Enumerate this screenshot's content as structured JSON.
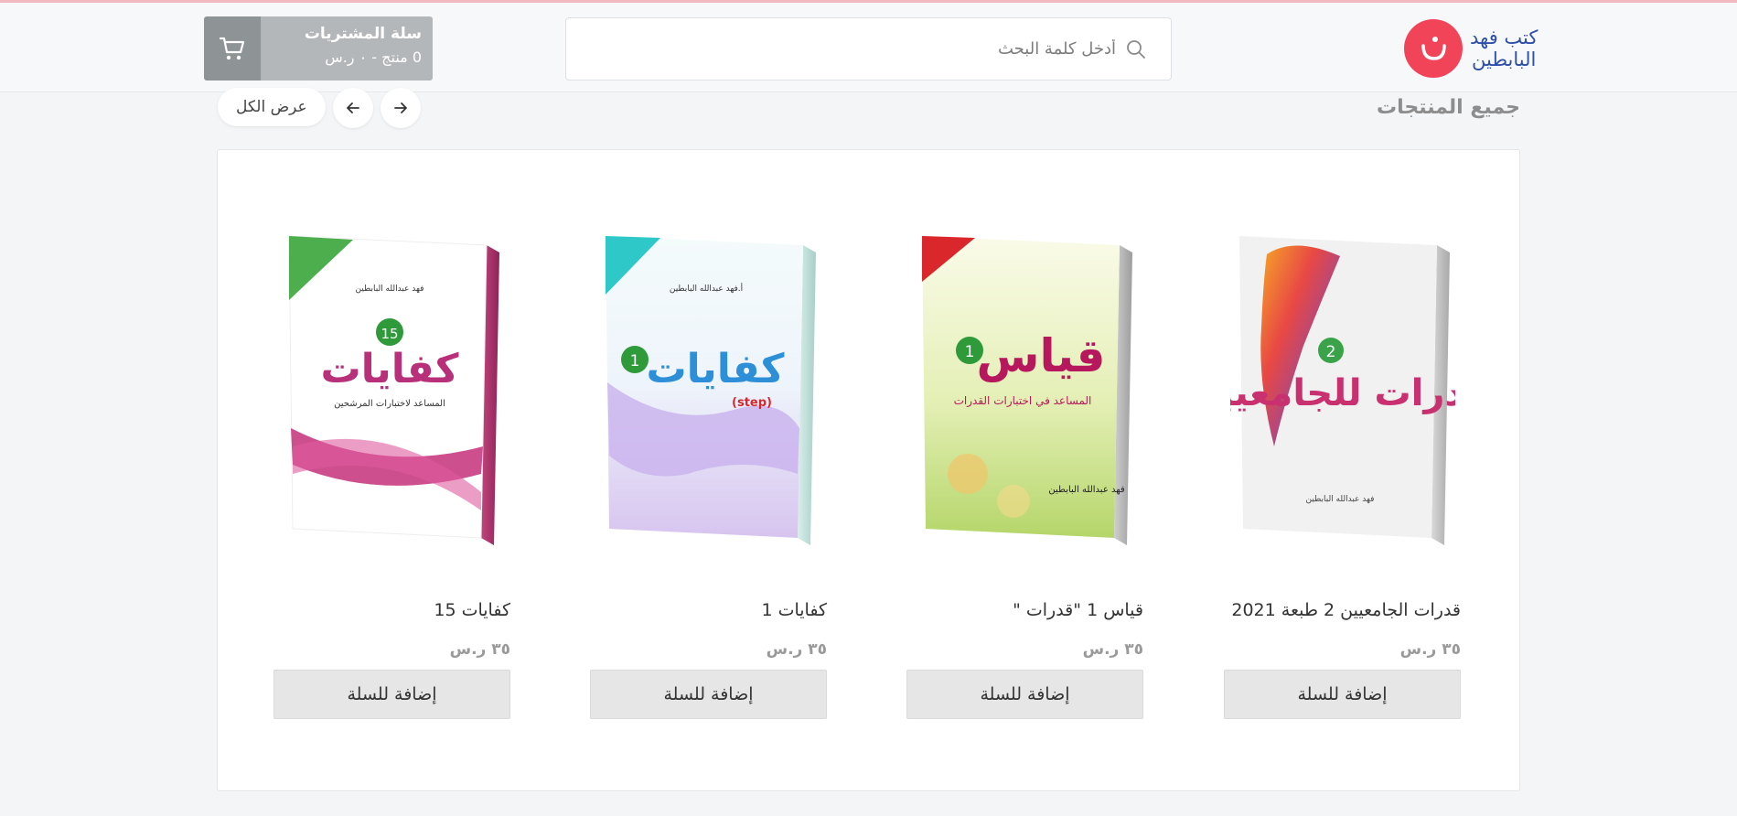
{
  "header": {
    "logo_line1": "كتب فهد",
    "logo_line2": "البابطين",
    "search_placeholder": "أدخل كلمة البحث",
    "cart_title": "سلة المشتريات",
    "cart_count": "0 منتج - ٠ ر.س"
  },
  "section": {
    "title": "جميع المنتجات",
    "view_all": "عرض الكل"
  },
  "products": [
    {
      "name": "قدرات الجامعيين 2 طبعة 2021",
      "price": "٣٥ ر.س",
      "add": "إضافة للسلة",
      "cover": {
        "title": "قدرات للجامعيين",
        "number": "2",
        "author": "فهد عبدالله البابطين"
      }
    },
    {
      "name": "قياس 1 \"قدرات \"",
      "price": "٣٥ ر.س",
      "add": "إضافة للسلة",
      "cover": {
        "title": "قياس",
        "subtitle": "المساعد في اختبارات القدرات",
        "number": "1",
        "author": "فهد عبدالله البابطين"
      }
    },
    {
      "name": "كفايات 1",
      "price": "٣٥ ر.س",
      "add": "إضافة للسلة",
      "cover": {
        "title": "كفايات",
        "subtitle": "(step)",
        "number": "1",
        "author": "أ.فهد عبدالله البابطين"
      }
    },
    {
      "name": "كفايات 15",
      "price": "٣٥ ر.س",
      "add": "إضافة للسلة",
      "cover": {
        "title": "كفايات",
        "subtitle": "المساعد لاختبارات المرشحين",
        "number": "15",
        "author": "فهد عبدالله البابطين"
      }
    }
  ],
  "colors": {
    "brand": "#f24458",
    "brand_text": "#2d4fa8",
    "cart_dark": "#8e9396",
    "cart_light": "#b4b7b9"
  }
}
